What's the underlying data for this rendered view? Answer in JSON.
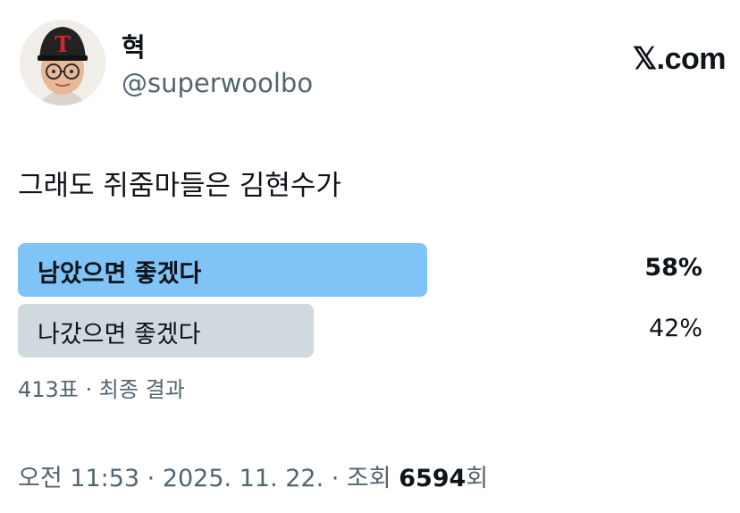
{
  "author": {
    "name": "혁",
    "handle": "@superwoolbo"
  },
  "brand": "𝕏.com",
  "tweet": {
    "text": "그래도 쥐줌마들은 김현수가"
  },
  "poll": {
    "options": [
      {
        "label": "남았으면 좋겠다",
        "percent_text": "58%",
        "percent": 58,
        "winner": true
      },
      {
        "label": "나갔으면 좋겠다",
        "percent_text": "42%",
        "percent": 42,
        "winner": false
      }
    ],
    "summary": "413표 · 최종 결과"
  },
  "meta": {
    "time": "오전 11:53",
    "separator": " · ",
    "date": "2025. 11. 22.",
    "views_prefix": "조회 ",
    "views_count": "6594",
    "views_suffix": "회"
  },
  "colors": {
    "poll_winner": "#7fc3f7",
    "poll_loser": "#cfd9de",
    "secondary_text": "#536471",
    "primary_text": "#0f1419"
  }
}
